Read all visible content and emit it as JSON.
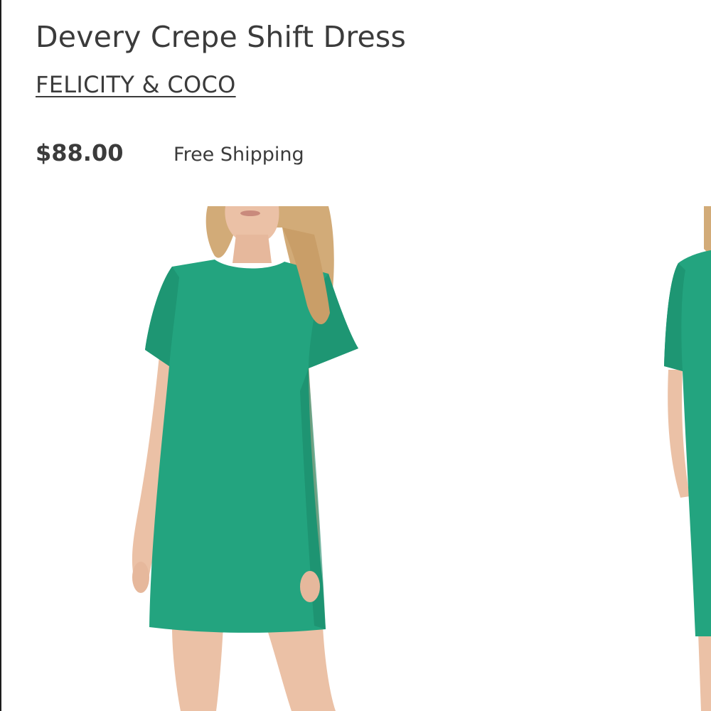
{
  "product": {
    "title": "Devery Crepe Shift Dress",
    "brand": "FELICITY & COCO",
    "price": "$88.00",
    "shipping": "Free Shipping"
  },
  "gallery": {
    "images": [
      {
        "subject": "front view, model wearing green short-sleeve shift dress"
      },
      {
        "subject": "side view, partially visible"
      }
    ]
  },
  "colors": {
    "text": "#3b3b3b",
    "dress": "#23a47f",
    "dress_shadow": "#1a8a69",
    "skin": "#ebc1a6",
    "hair": "#d2ab78"
  }
}
